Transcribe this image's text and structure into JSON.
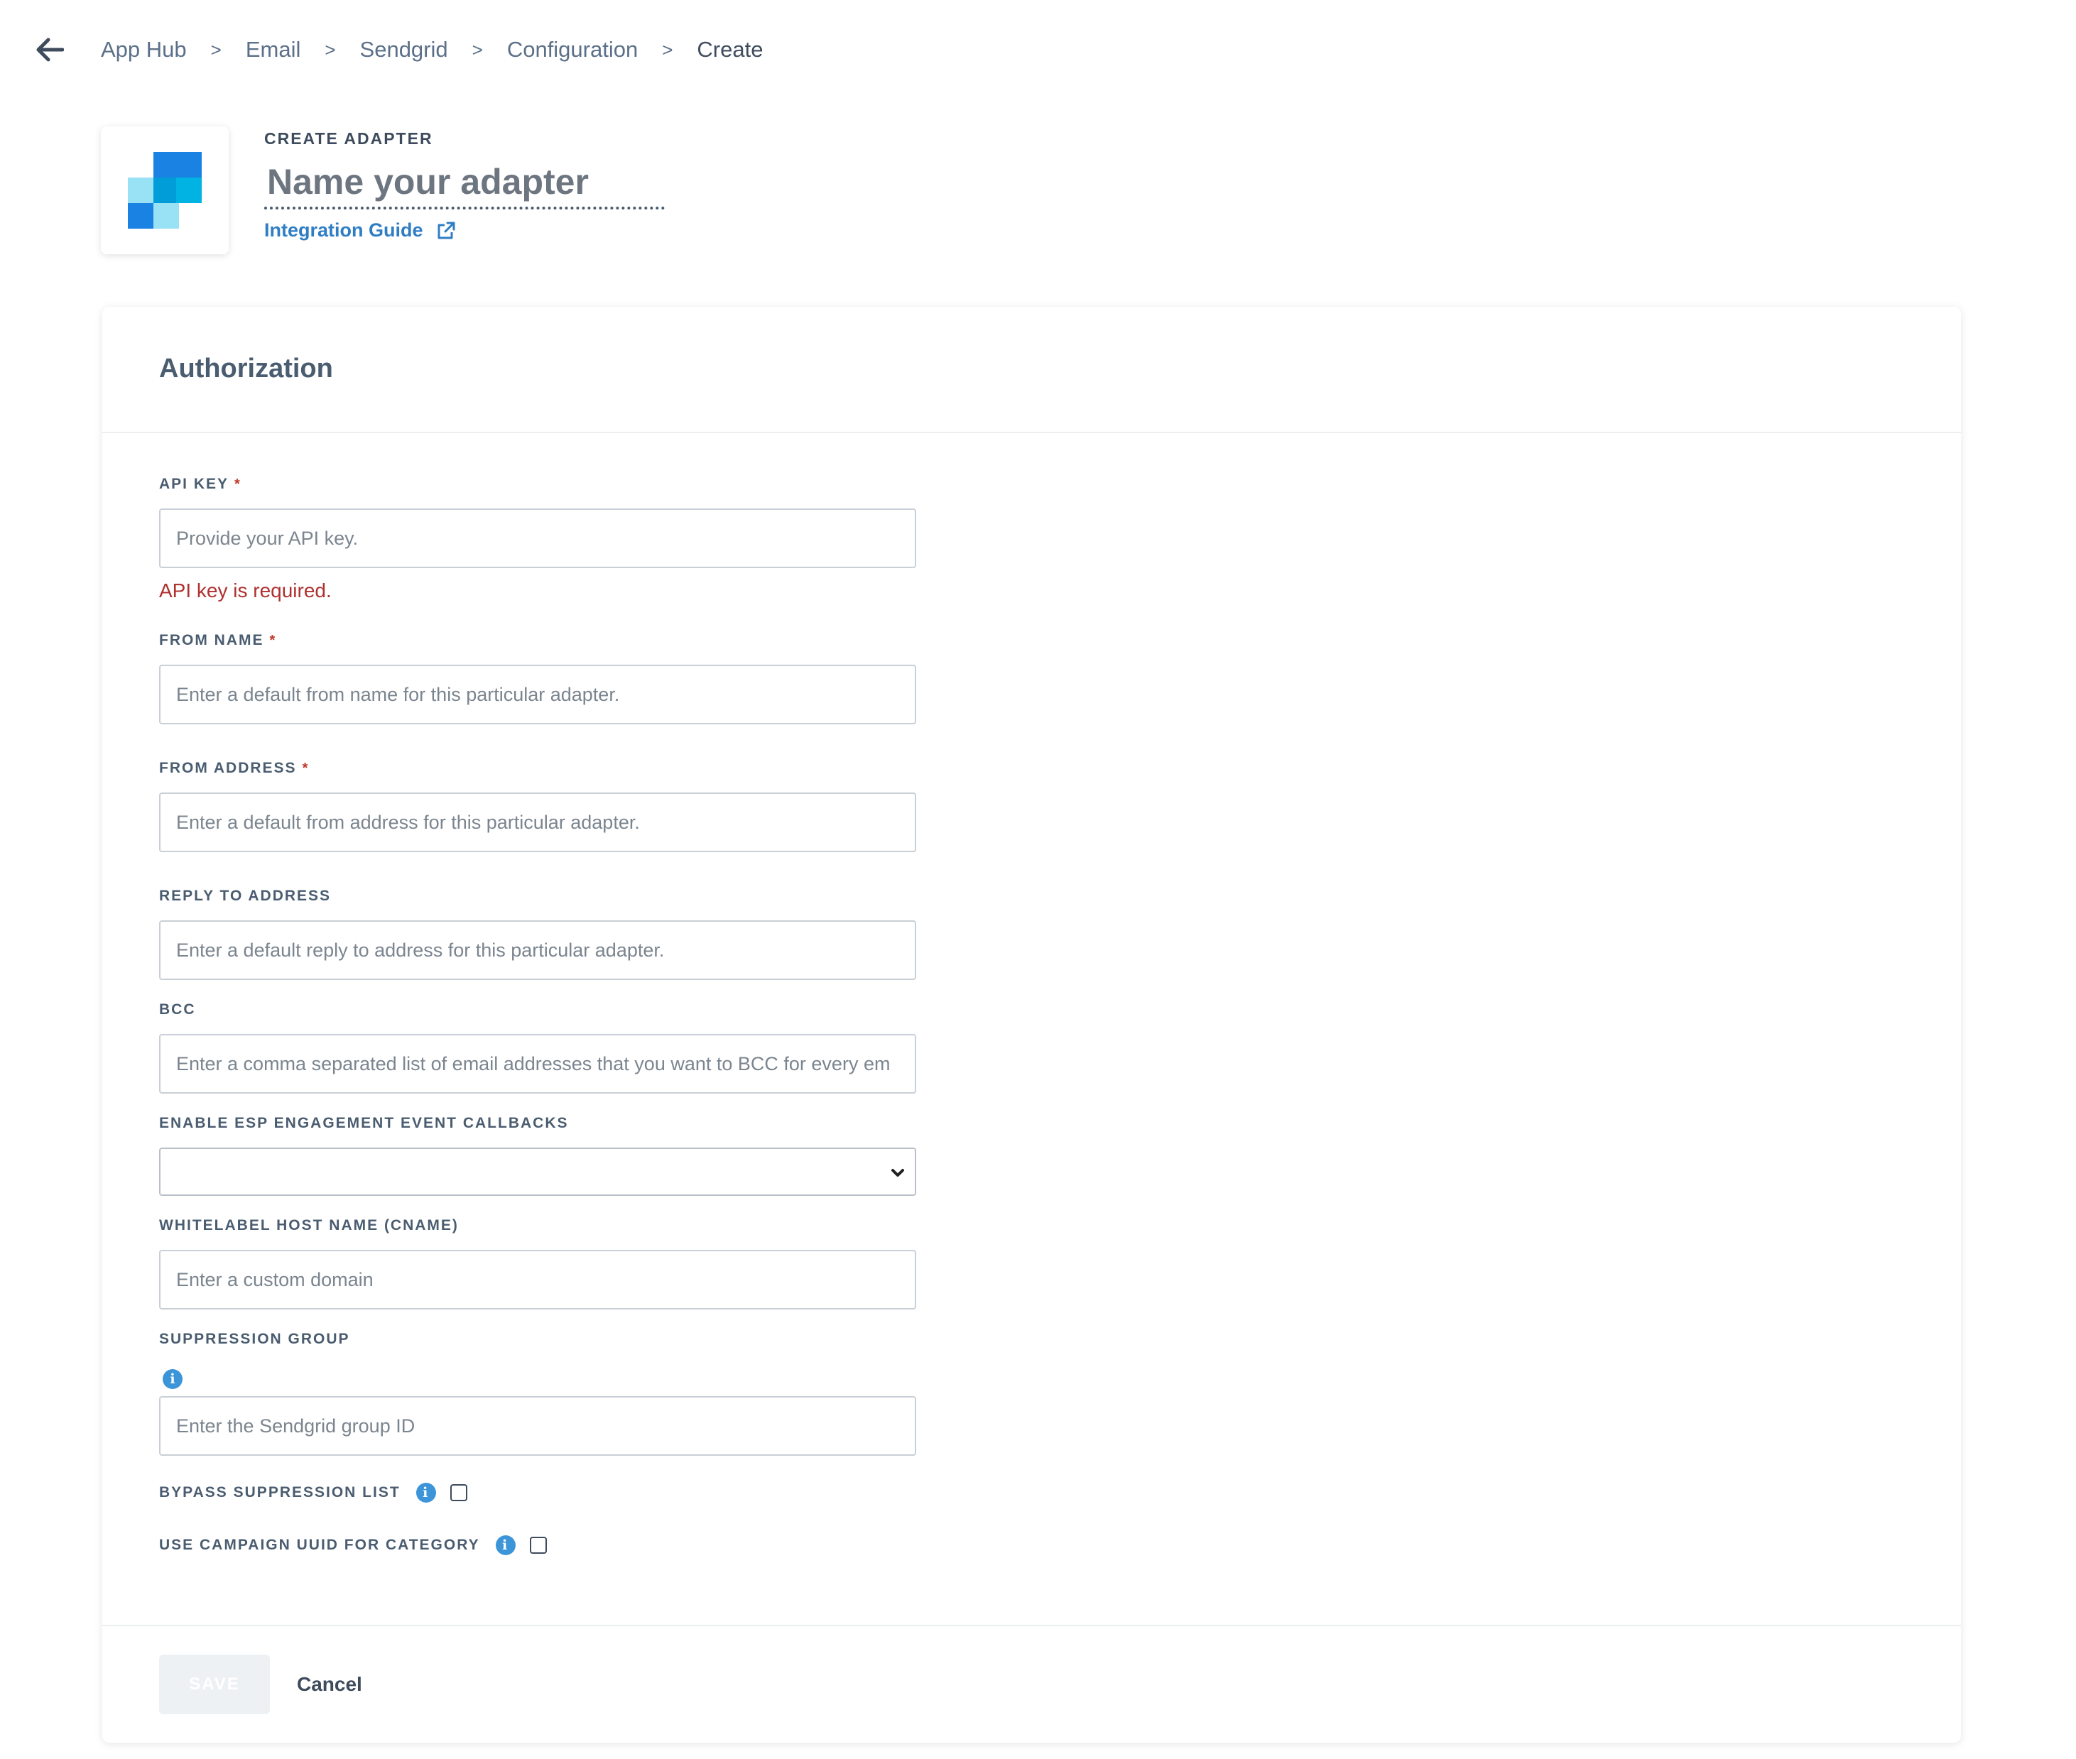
{
  "breadcrumb": {
    "items": [
      "App Hub",
      "Email",
      "Sendgrid",
      "Configuration"
    ],
    "current": "Create",
    "separator": ">"
  },
  "header": {
    "eyebrow": "CREATE ADAPTER",
    "name_placeholder": "Name your adapter",
    "guide_link": "Integration Guide"
  },
  "card": {
    "title": "Authorization",
    "fields": {
      "api_key": {
        "label": "API KEY",
        "required": "*",
        "placeholder": "Provide your API key.",
        "error": "API key is required."
      },
      "from_name": {
        "label": "FROM NAME",
        "required": "*",
        "placeholder": "Enter a default from name for this particular adapter."
      },
      "from_address": {
        "label": "FROM ADDRESS",
        "required": "*",
        "placeholder": "Enter a default from address for this particular adapter."
      },
      "reply_to": {
        "label": "REPLY TO ADDRESS",
        "placeholder": "Enter a default reply to address for this particular adapter."
      },
      "bcc": {
        "label": "BCC",
        "placeholder": "Enter a comma separated list of email addresses that you want to BCC for every em"
      },
      "esp_callbacks": {
        "label": "ENABLE ESP ENGAGEMENT EVENT CALLBACKS",
        "value": ""
      },
      "whitelabel": {
        "label": "WHITELABEL HOST NAME (CNAME)",
        "placeholder": "Enter a custom domain"
      },
      "suppression_group": {
        "label": "SUPPRESSION GROUP",
        "placeholder": "Enter the Sendgrid group ID"
      },
      "bypass_suppression": {
        "label": "BYPASS SUPPRESSION LIST",
        "checked": false
      },
      "campaign_uuid": {
        "label": "USE CAMPAIGN UUID FOR CATEGORY",
        "checked": false
      }
    }
  },
  "footer": {
    "save_label": "SAVE",
    "cancel_label": "Cancel"
  },
  "icons": {
    "back": "arrow-left-icon",
    "external": "external-link-icon",
    "info": "info-icon",
    "chevron": "chevron-down-icon",
    "logo": "sendgrid-logo"
  },
  "colors": {
    "link": "#2f7ec4",
    "error": "#b03030",
    "info": "#3c95d8",
    "required": "#c0392b"
  }
}
